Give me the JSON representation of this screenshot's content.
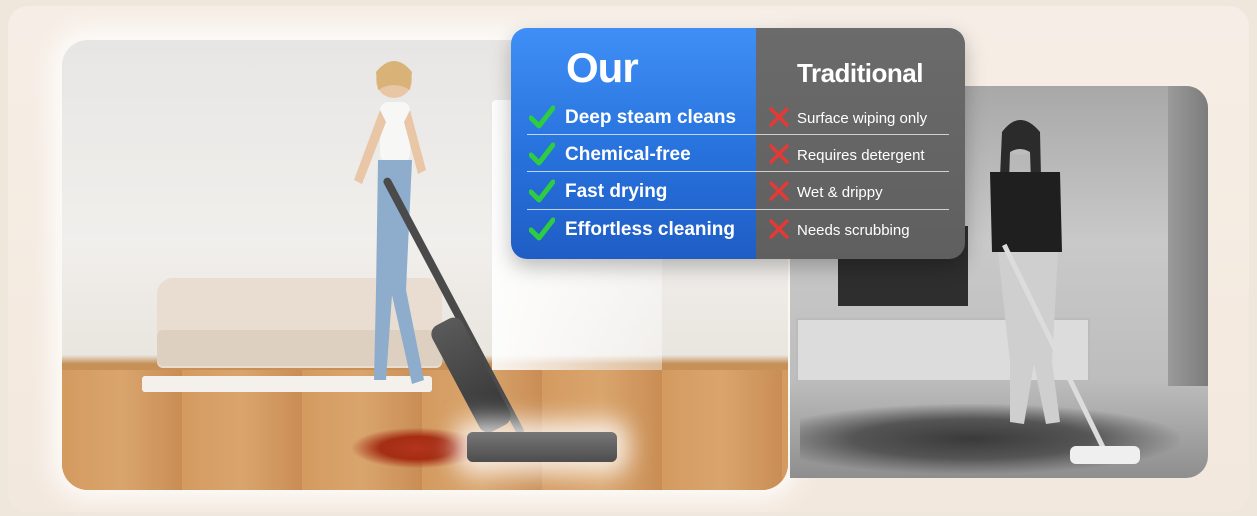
{
  "comparison": {
    "ours_heading": "Our",
    "traditional_heading": "Traditional",
    "ours_color": "#2f7de8",
    "traditional_color": "#666666",
    "check_color": "#2ecc40",
    "cross_color": "#e53935",
    "rows": [
      {
        "ours": "Deep steam cleans",
        "traditional": "Surface wiping only"
      },
      {
        "ours": "Chemical-free",
        "traditional": "Requires detergent"
      },
      {
        "ours": "Fast drying",
        "traditional": "Wet & drippy"
      },
      {
        "ours": "Effortless cleaning",
        "traditional": "Needs scrubbing"
      }
    ]
  },
  "images": {
    "left": "woman-steam-mopping-icon",
    "right": "woman-manual-mopping-icon"
  }
}
